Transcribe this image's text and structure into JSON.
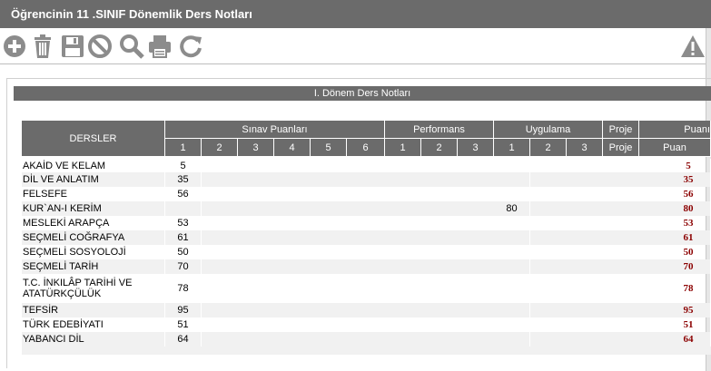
{
  "window": {
    "title": "Öğrencinin  11 .SINIF Dönemlik Ders Notları"
  },
  "toolbar": {
    "icons": [
      "add-icon",
      "trash-icon",
      "save-icon",
      "cancel-icon",
      "search-icon",
      "print-icon",
      "refresh-icon",
      "warning-icon"
    ]
  },
  "section": {
    "title": "I. Dönem Ders Notları"
  },
  "table": {
    "header": {
      "dersler": "DERSLER",
      "sinav": "Sınav Puanları",
      "performans": "Performans",
      "uygulama": "Uygulama",
      "proje": "Proje",
      "puan_group": "Puanı",
      "sinav_cols": [
        "1",
        "2",
        "3",
        "4",
        "5",
        "6"
      ],
      "performans_cols": [
        "1",
        "2",
        "3"
      ],
      "uygulama_cols": [
        "1",
        "2",
        "3"
      ],
      "proje_col": "Proje",
      "puan_col": "Puan"
    },
    "rows": [
      {
        "name": "AKAİD VE KELAM",
        "s1": "5",
        "u1": "",
        "puan": "5"
      },
      {
        "name": "DİL VE ANLATIM",
        "s1": "35",
        "u1": "",
        "puan": "35"
      },
      {
        "name": "FELSEFE",
        "s1": "56",
        "u1": "",
        "puan": "56"
      },
      {
        "name": "KUR`AN-I KERİM",
        "s1": "",
        "u1": "80",
        "puan": "80"
      },
      {
        "name": "MESLEKİ ARAPÇA",
        "s1": "53",
        "u1": "",
        "puan": "53"
      },
      {
        "name": "SEÇMELİ COĞRAFYA",
        "s1": "61",
        "u1": "",
        "puan": "61"
      },
      {
        "name": "SEÇMELİ SOSYOLOJİ",
        "s1": "50",
        "u1": "",
        "puan": "50"
      },
      {
        "name": "SEÇMELİ TARİH",
        "s1": "70",
        "u1": "",
        "puan": "70"
      },
      {
        "name": "T.C. İNKILÂP TARİHİ VE ATATÜRKÇÜLÜK",
        "s1": "78",
        "u1": "",
        "puan": "78"
      },
      {
        "name": "TEFSİR",
        "s1": "95",
        "u1": "",
        "puan": "95"
      },
      {
        "name": "TÜRK EDEBİYATI",
        "s1": "51",
        "u1": "",
        "puan": "51"
      },
      {
        "name": "YABANCI DİL",
        "s1": "64",
        "u1": "",
        "puan": "64"
      }
    ]
  },
  "colors": {
    "header_bg": "#6b6b6b",
    "puan_text": "#8b0000",
    "icon_gray": "#8c8c8c"
  }
}
